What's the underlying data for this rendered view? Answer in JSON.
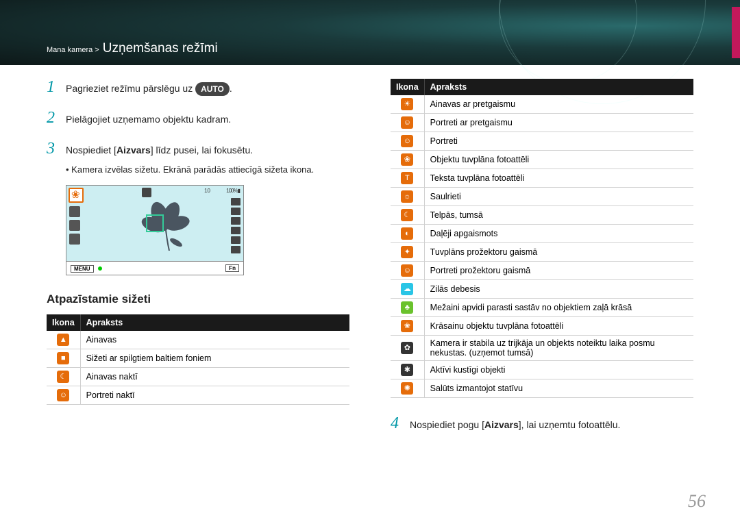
{
  "breadcrumb": {
    "path": "Mana kamera >",
    "title": "Uzņemšanas režīmi"
  },
  "steps": {
    "s1": {
      "num": "1",
      "pre": "Pagrieziet režīmu pārslēgu uz ",
      "badge": "AUTO",
      "post": "."
    },
    "s2": {
      "num": "2",
      "text": "Pielāgojiet uzņemamo objektu kadram."
    },
    "s3": {
      "num": "3",
      "pre": "Nospiediet [",
      "bold": "Aizvars",
      "post": "] līdz pusei, lai fokusētu."
    },
    "s3_bullet": "Kamera izvēlas sižetu. Ekrānā parādās attiecīgā sižeta ikona.",
    "s4": {
      "num": "4",
      "pre": "Nospiediet pogu [",
      "bold": "Aizvars",
      "post": "], lai uzņemtu fotoattēlu."
    }
  },
  "screen": {
    "menu": "MENU",
    "fn": "Fn",
    "count": "10",
    "batt": "100%▮"
  },
  "subheading": "Atpazīstamie sižeti",
  "thead": {
    "icon": "Ikona",
    "desc": "Apraksts"
  },
  "left_rows": [
    {
      "bg": "#e56c0a",
      "glyph": "▲",
      "text": "Ainavas"
    },
    {
      "bg": "#e56c0a",
      "glyph": "■",
      "text": "Sižeti ar spilgtiem baltiem foniem"
    },
    {
      "bg": "#e56c0a",
      "glyph": "☾",
      "text": "Ainavas naktī"
    },
    {
      "bg": "#e56c0a",
      "glyph": "☺",
      "text": "Portreti naktī"
    }
  ],
  "right_rows": [
    {
      "bg": "#e56c0a",
      "glyph": "☀",
      "text": "Ainavas ar pretgaismu"
    },
    {
      "bg": "#e56c0a",
      "glyph": "☺",
      "text": "Portreti ar pretgaismu"
    },
    {
      "bg": "#e56c0a",
      "glyph": "☺",
      "text": "Portreti"
    },
    {
      "bg": "#e56c0a",
      "glyph": "❀",
      "text": "Objektu tuvplāna fotoattēli"
    },
    {
      "bg": "#e56c0a",
      "glyph": "T",
      "text": "Teksta tuvplāna fotoattēli"
    },
    {
      "bg": "#e56c0a",
      "glyph": "☼",
      "text": "Saulrieti"
    },
    {
      "bg": "#e56c0a",
      "glyph": "☾",
      "text": "Telpās, tumsā"
    },
    {
      "bg": "#e56c0a",
      "glyph": "◐",
      "text": "Daļēji apgaismots"
    },
    {
      "bg": "#e56c0a",
      "glyph": "✦",
      "text": "Tuvplāns prožektoru gaismā"
    },
    {
      "bg": "#e56c0a",
      "glyph": "☺",
      "text": "Portreti prožektoru gaismā"
    },
    {
      "bg": "#29c5e6",
      "glyph": "☁",
      "text": "Zilās debesis"
    },
    {
      "bg": "#6ac22d",
      "glyph": "♣",
      "text": "Mežaini apvidi parasti sastāv no objektiem zaļā krāsā"
    },
    {
      "bg": "#e56c0a",
      "glyph": "❀",
      "text": "Krāsainu objektu tuvplāna fotoattēli"
    },
    {
      "bg": "#333333",
      "glyph": "✿",
      "text": "Kamera ir stabila uz trijkāja un objekts noteiktu laika posmu nekustas. (uzņemot tumsā)"
    },
    {
      "bg": "#333333",
      "glyph": "✱",
      "text": "Aktīvi kustīgi objekti"
    },
    {
      "bg": "#e56c0a",
      "glyph": "✺",
      "text": "Salūts izmantojot statīvu"
    }
  ],
  "pagenum": "56"
}
